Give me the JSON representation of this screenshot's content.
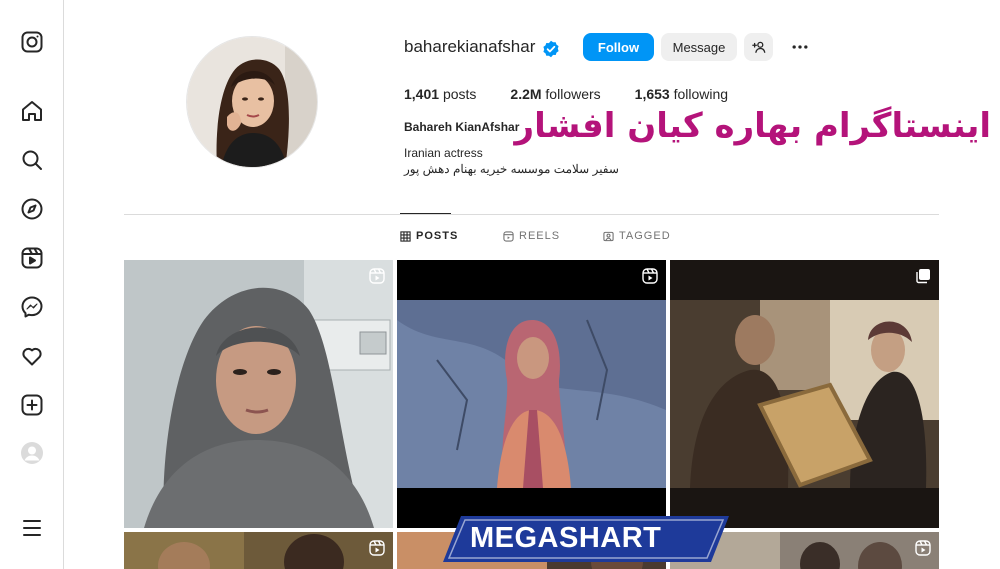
{
  "sidebar": {
    "items": [
      {
        "name": "instagram-logo-icon"
      },
      {
        "name": "home-icon"
      },
      {
        "name": "search-icon"
      },
      {
        "name": "explore-icon"
      },
      {
        "name": "reels-icon"
      },
      {
        "name": "messenger-icon"
      },
      {
        "name": "notifications-heart-icon"
      },
      {
        "name": "create-icon"
      },
      {
        "name": "profile-avatar-icon"
      },
      {
        "name": "menu-icon"
      }
    ]
  },
  "profile": {
    "username": "baharekianafshar",
    "verified": true,
    "follow_label": "Follow",
    "message_label": "Message",
    "stats": {
      "posts_count": "1,401",
      "posts_label": "posts",
      "followers_count": "2.2M",
      "followers_label": "followers",
      "following_count": "1,653",
      "following_label": "following"
    },
    "full_name": "Bahareh KianAfshar",
    "bio_line1": "Iranian actress",
    "bio_line2": "سفیر سلامت موسسه خیریه بهنام دهش پور"
  },
  "overlay": {
    "title": "اینستاگرام بهاره کیان افشار",
    "watermark": "MEGASHART"
  },
  "tabs": [
    {
      "label": "POSTS",
      "active": true
    },
    {
      "label": "REELS",
      "active": false
    },
    {
      "label": "TAGGED",
      "active": false
    }
  ],
  "posts": [
    {
      "type": "reel"
    },
    {
      "type": "reel"
    },
    {
      "type": "carousel"
    },
    {
      "type": "reel"
    },
    {
      "type": "reel"
    },
    {
      "type": "reel"
    }
  ],
  "colors": {
    "accent": "#0095f6",
    "overlay_title": "#b4137a",
    "watermark_bg": "#1e3a9a"
  }
}
